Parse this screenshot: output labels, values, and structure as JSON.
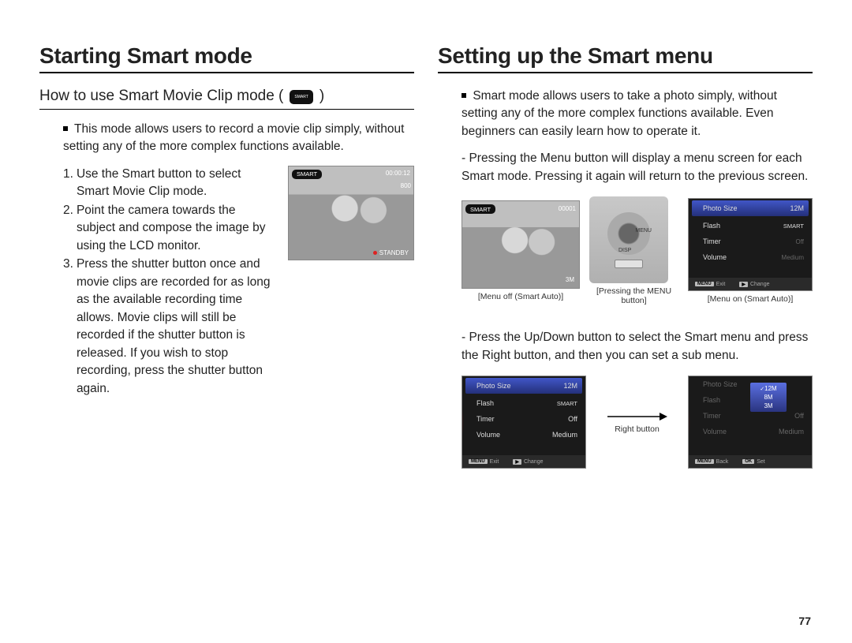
{
  "page_number": "77",
  "left": {
    "title": "Starting Smart mode",
    "subhead": "How to use Smart Movie Clip mode (",
    "subhead_tail": ")",
    "chip": "SMART",
    "intro": "This mode allows users to record a movie clip simply, without setting any of the more complex functions available.",
    "steps": [
      "Use the Smart button to select Smart Movie Clip mode.",
      "Point the camera towards the subject and compose the image by using the LCD monitor.",
      "Press the shutter button once and movie clips are recorded for as long as the available recording time allows. Movie clips will still be recorded if the shutter button is released. If you wish to stop recording, press the shutter button again."
    ],
    "lcd": {
      "time": "00:00:12",
      "badge": "SMART",
      "res": "800",
      "standby": "STANDBY"
    }
  },
  "right": {
    "title": "Setting up the Smart menu",
    "intro": "Smart mode allows users to take a photo simply, without setting any of the more complex functions available. Even beginners can easily learn how to operate it.",
    "dash1": "- Pressing the Menu button will display a menu screen for each Smart mode. Pressing it again will return to the previous screen.",
    "dash2": "- Press the Up/Down button to select the Smart menu and press the Right button, and then you can set a sub menu.",
    "menu_items": {
      "photoSize": "Photo Size",
      "flash": "Flash",
      "timer": "Timer",
      "volume": "Volume",
      "val_photoSize": "12M",
      "val_flash": "SMART",
      "val_timer": "Off",
      "val_volume": "Medium"
    },
    "foot": {
      "menu": "MENU",
      "exit": "Exit",
      "play": "▶",
      "change": "Change",
      "back": "Back",
      "ok": "OK",
      "set": "Set"
    },
    "captions": {
      "menuOff": "[Menu off (Smart Auto)]",
      "menuOn": "[Menu on (Smart Auto)]",
      "pressing": "[Pressing the MENU button]",
      "right": "Right button"
    },
    "lcd2": {
      "count": "00001",
      "res": "3M"
    },
    "cam": {
      "menu": "MENU",
      "disp": "DISP"
    },
    "submenu": [
      "12M",
      "8M",
      "3M"
    ]
  }
}
